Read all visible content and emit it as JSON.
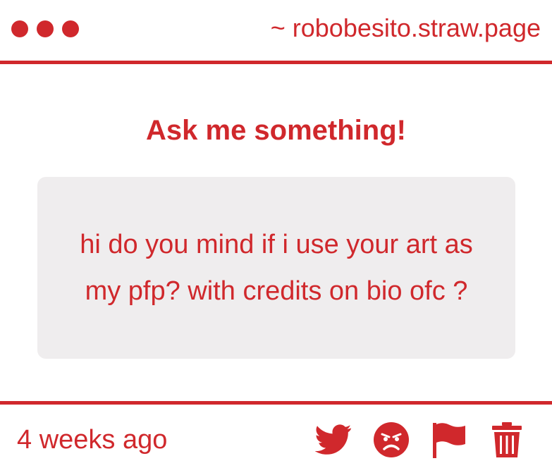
{
  "header": {
    "site": "~ robobesito.straw.page"
  },
  "title": "Ask me something!",
  "question": {
    "text": "hi do you mind if i use your art as my pfp? with credits on bio ofc ?"
  },
  "footer": {
    "timestamp": "4 weeks ago",
    "actions": [
      {
        "icon": "twitter-icon"
      },
      {
        "icon": "angry-face-icon"
      },
      {
        "icon": "flag-icon"
      },
      {
        "icon": "trash-icon"
      }
    ]
  },
  "colors": {
    "accent": "#d0282c",
    "box": "#efedee",
    "background": "#ffffff"
  }
}
